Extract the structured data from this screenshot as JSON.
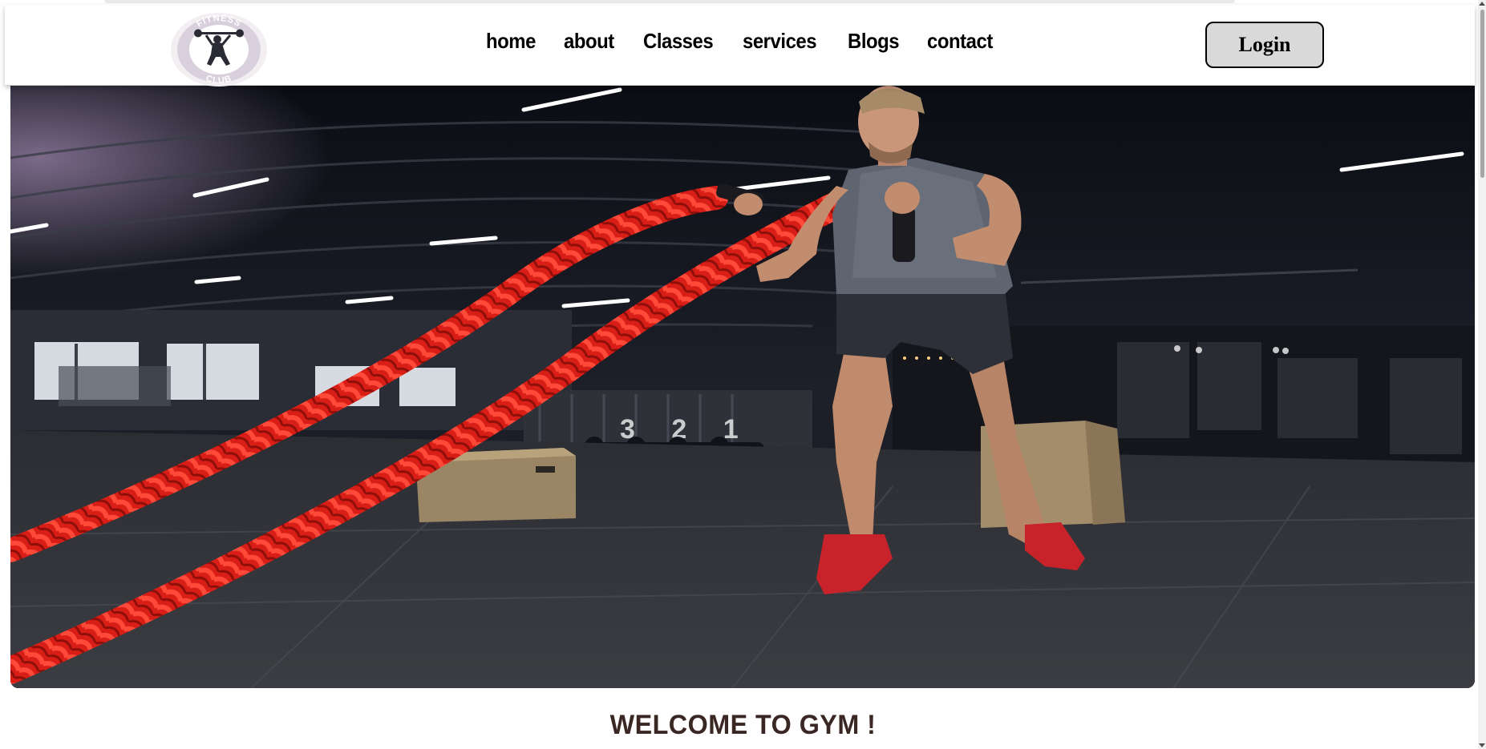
{
  "header": {
    "logo": {
      "icon": "fitness-club-logo",
      "text_top": "FITNESS",
      "text_bottom": "CLUB"
    },
    "nav": [
      {
        "id": "home",
        "label": "home"
      },
      {
        "id": "about",
        "label": "about"
      },
      {
        "id": "classes",
        "label": "Classes"
      },
      {
        "id": "services",
        "label": "services"
      },
      {
        "id": "blogs",
        "label": "Blogs"
      },
      {
        "id": "contact",
        "label": "contact"
      }
    ],
    "login_label": "Login"
  },
  "hero": {
    "image": "man-training-with-battle-ropes-in-dark-gym",
    "countdown_numbers": "3 2 1"
  },
  "welcome": {
    "heading": "WELCOME TO GYM !"
  },
  "colors": {
    "accent_rope": "#e3241c",
    "heading": "#3a2622",
    "login_bg": "#d9d9d9"
  }
}
